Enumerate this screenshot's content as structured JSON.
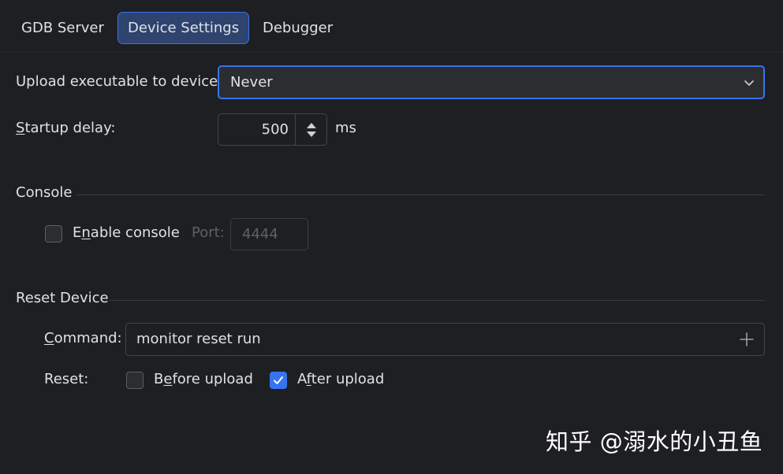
{
  "tabs": [
    {
      "label": "GDB Server",
      "active": false
    },
    {
      "label": "Device Settings",
      "active": true
    },
    {
      "label": "Debugger",
      "active": false
    }
  ],
  "upload": {
    "label": "Upload executable to device:",
    "value": "Never"
  },
  "startup": {
    "label_mnemonic": "S",
    "label_rest": "tartup delay:",
    "value": "500",
    "unit": "ms"
  },
  "console": {
    "section_title": "Console",
    "enable_mnemonic_pre": "E",
    "enable_mnemonic": "n",
    "enable_rest": "able console",
    "enable_checked": false,
    "port_label": "Port:",
    "port_value": "4444"
  },
  "reset_device": {
    "section_title": "Reset Device",
    "command_mnemonic": "C",
    "command_rest": "ommand:",
    "command_value": "monitor reset run",
    "reset_label": "Reset:",
    "before_pre": "B",
    "before_mnemonic": "e",
    "before_rest": "fore upload",
    "before_checked": false,
    "after_pre": "A",
    "after_mnemonic": "f",
    "after_rest": "ter upload",
    "after_checked": true
  },
  "watermark": "知乎 @溺水的小丑鱼",
  "colors": {
    "background": "#1e1f22",
    "accent": "#3574f0",
    "active_tab_bg": "#2e436e",
    "text": "#dfe1e5",
    "disabled_text": "#5d6066"
  },
  "icons": {
    "combo_arrow": "chevron-down-icon",
    "spinner_arrows": "spinner-arrows-icon",
    "add": "plus-icon",
    "check": "checkmark-icon"
  }
}
